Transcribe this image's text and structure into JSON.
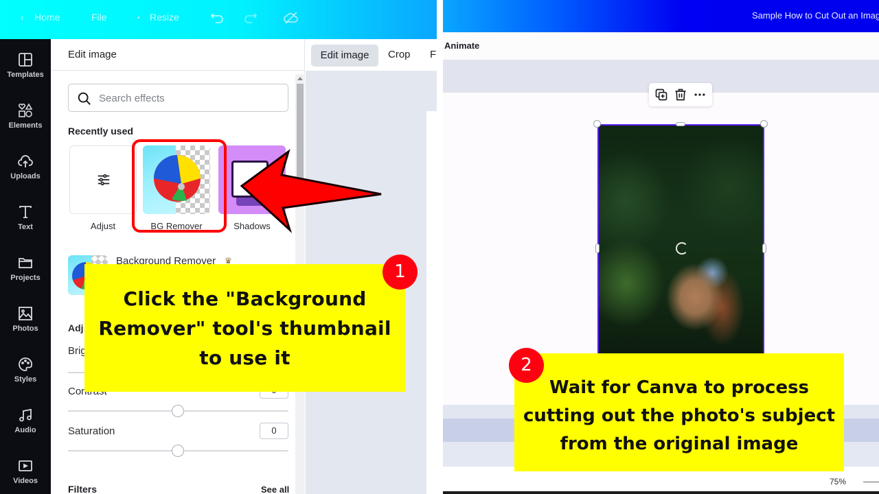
{
  "left_screen": {
    "topbar": {
      "back_icon": "chevron-left-icon",
      "home_label": "Home",
      "file_label": "File",
      "resize_label": "Resize",
      "undo_icon": "undo-icon",
      "redo_icon": "redo-icon",
      "cloud_icon": "cloud-sync-icon"
    },
    "sidebar": {
      "items": [
        {
          "label": "Templates",
          "icon": "templates-icon"
        },
        {
          "label": "Elements",
          "icon": "elements-icon"
        },
        {
          "label": "Uploads",
          "icon": "upload-icon"
        },
        {
          "label": "Text",
          "icon": "text-icon"
        },
        {
          "label": "Projects",
          "icon": "folder-icon"
        },
        {
          "label": "Photos",
          "icon": "photo-icon"
        },
        {
          "label": "Styles",
          "icon": "palette-icon"
        },
        {
          "label": "Audio",
          "icon": "music-icon"
        },
        {
          "label": "Videos",
          "icon": "video-icon"
        }
      ]
    },
    "panel": {
      "title": "Edit image",
      "search_placeholder": "Search effects",
      "recently_used_title": "Recently used",
      "recent_tiles": [
        {
          "label": "Adjust"
        },
        {
          "label": "BG Remover"
        },
        {
          "label": "Shadows"
        }
      ],
      "bg_remover_row_label": "Background Remover",
      "bg_remover_row_badge": "♛",
      "adjust_title_partial": "Adj",
      "brightness_label_partial": "Brig",
      "contrast_label": "Contrast",
      "contrast_value": "0",
      "saturation_label": "Saturation",
      "saturation_value": "0",
      "filters_title": "Filters",
      "see_all_label": "See all"
    },
    "toolbar": {
      "edit_image_label": "Edit image",
      "crop_label": "Crop",
      "flip_label_partial": "F"
    }
  },
  "right_screen": {
    "doc_title": "Sample How to Cut Out an Image",
    "animate_label": "Animate",
    "float_toolbar": {
      "duplicate_icon": "duplicate-icon",
      "delete_icon": "trash-icon",
      "more_icon": "more-icon"
    },
    "photo_alt": "Family hugging in front of green foliage",
    "zoom_level": "75%"
  },
  "annotations": {
    "step1": {
      "number": "1",
      "text": "Click the \"Background Remover\" tool's thumbnail to use it"
    },
    "step2": {
      "number": "2",
      "text": "Wait for Canva to process cutting out the photo's subject from the original image"
    }
  },
  "colors": {
    "callout_bg": "#ffff00",
    "badge_red": "#ff0010",
    "highlight_red": "#ff0000",
    "left_topbar": "#00ffff",
    "right_topbar": "#0000f2",
    "sidebar_bg": "#0b0d12"
  }
}
